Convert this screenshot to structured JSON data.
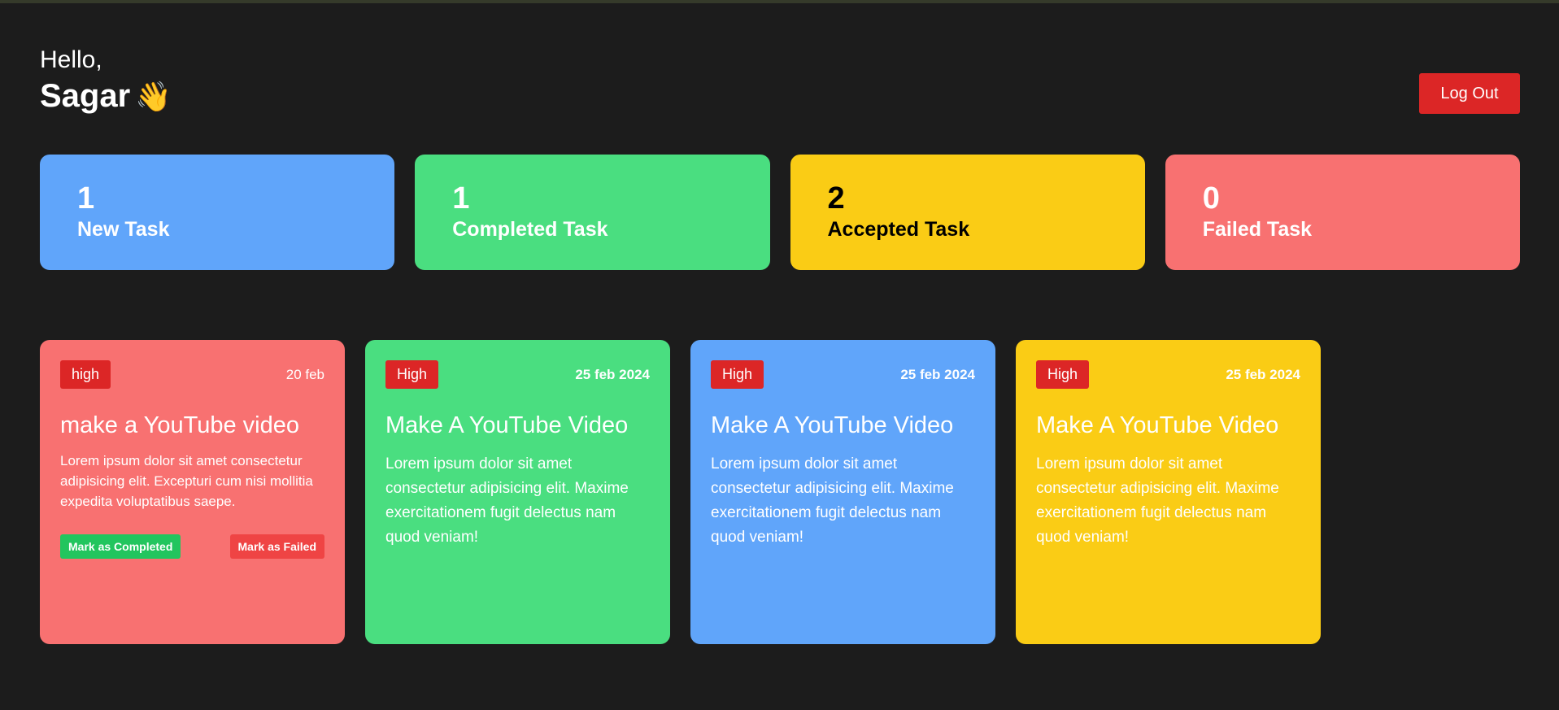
{
  "header": {
    "greeting": "Hello,",
    "username": "Sagar",
    "wave_emoji": "👋",
    "logout_label": "Log Out"
  },
  "stats": [
    {
      "count": "1",
      "label": "New Task",
      "color": "#60a5fa",
      "text_color": "#ffffff"
    },
    {
      "count": "1",
      "label": "Completed Task",
      "color": "#4ade80",
      "text_color": "#ffffff"
    },
    {
      "count": "2",
      "label": "Accepted Task",
      "color": "#facc15",
      "text_color": "#000000"
    },
    {
      "count": "0",
      "label": "Failed Task",
      "color": "#f87171",
      "text_color": "#ffffff"
    }
  ],
  "tasks": [
    {
      "priority": "high",
      "date": "20 feb",
      "title": "make a YouTube video",
      "description": "Lorem ipsum dolor sit amet consectetur adipisicing elit. Excepturi cum nisi mollitia expedita voluptatibus saepe.",
      "color": "#f87171",
      "actions": {
        "complete": "Mark as Completed",
        "fail": "Mark as Failed"
      }
    },
    {
      "priority": "High",
      "date": "25 feb 2024",
      "title": "Make A YouTube Video",
      "description": "Lorem ipsum dolor sit amet consectetur adipisicing elit. Maxime exercitationem fugit delectus nam quod veniam!",
      "color": "#4ade80"
    },
    {
      "priority": "High",
      "date": "25 feb 2024",
      "title": "Make A YouTube Video",
      "description": "Lorem ipsum dolor sit amet consectetur adipisicing elit. Maxime exercitationem fugit delectus nam quod veniam!",
      "color": "#60a5fa"
    },
    {
      "priority": "High",
      "date": "25 feb 2024",
      "title": "Make A YouTube Video",
      "description": "Lorem ipsum dolor sit amet consectetur adipisicing elit. Maxime exercitationem fugit delectus nam quod veniam!",
      "color": "#facc15"
    }
  ],
  "colors": {
    "background": "#1c1c1c",
    "danger": "#dc2626",
    "success_button": "#22c55e",
    "fail_button": "#ef4444"
  }
}
